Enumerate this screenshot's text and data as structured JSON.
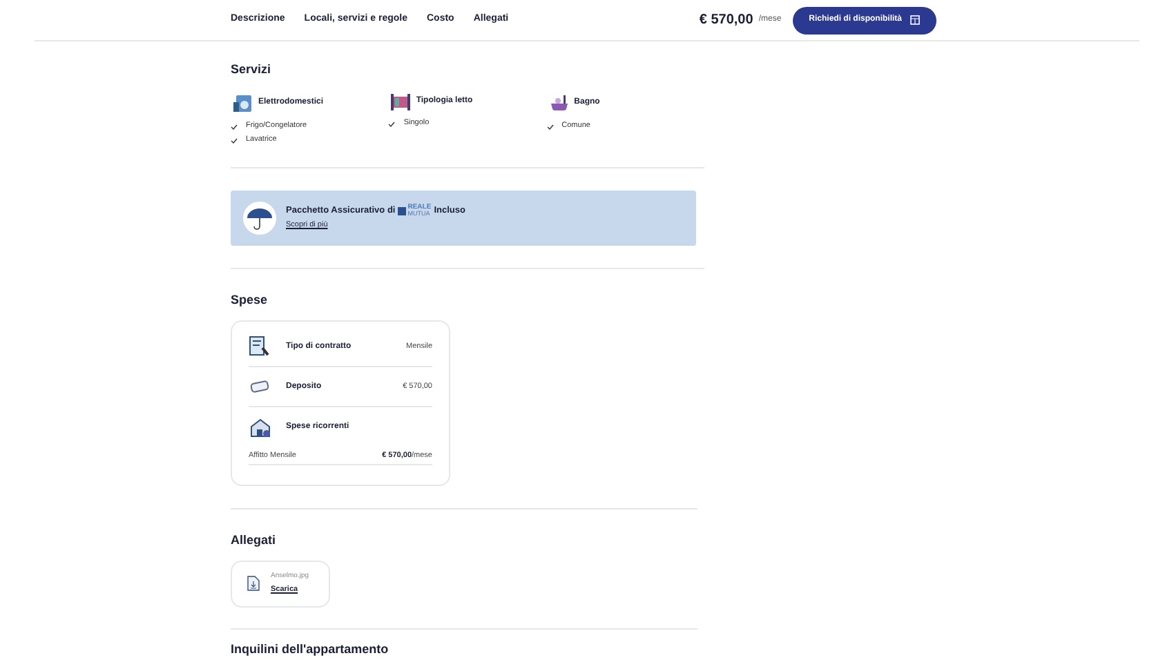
{
  "nav": {
    "tabs": [
      {
        "label": "Descrizione",
        "selected": false
      },
      {
        "label": "Locali, servizi e regole",
        "selected": false
      },
      {
        "label": "Costo",
        "selected": false
      },
      {
        "label": "Allegati",
        "selected": false
      }
    ],
    "price": "€ 570,00",
    "price_unit": "/mese",
    "cta": "Richiedi di disponibilità"
  },
  "services": {
    "title": "Servizi",
    "groups": [
      {
        "kind": "appliances",
        "title": "Elettrodomestici",
        "items": [
          "Frigo/Congelatore",
          "Lavatrice"
        ]
      },
      {
        "kind": "bed",
        "title": "Tipologia letto",
        "items": [
          "Singolo"
        ]
      },
      {
        "kind": "bath",
        "title": "Bagno",
        "items": [
          "Comune"
        ]
      }
    ]
  },
  "insurance": {
    "text_before": "Pacchetto Assicurativo di",
    "logo_top": "REALE",
    "logo_bottom": "MUTUA",
    "text_after": "Incluso",
    "link": "Scopri di più"
  },
  "expenses": {
    "title": "Spese",
    "rows": [
      {
        "kind": "contract",
        "label": "Tipo di contratto",
        "value": "Mensile"
      },
      {
        "kind": "deposit",
        "label": "Deposito",
        "value": "€ 570,00"
      },
      {
        "kind": "recurring",
        "label": "Spese ricorrenti"
      }
    ],
    "recurring": {
      "label": "Affitto Mensile",
      "amount": "€ 570,00",
      "unit": "/mese"
    }
  },
  "attachments": {
    "title": "Allegati",
    "files": [
      {
        "name": "Anselmo.jpg",
        "link": "Scarica"
      }
    ]
  },
  "next_section": {
    "title": "Inquilini dell'appartamento"
  }
}
